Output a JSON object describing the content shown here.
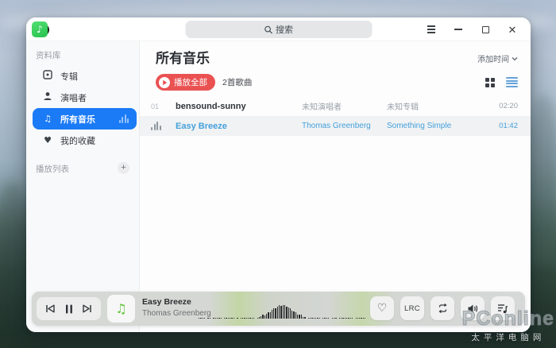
{
  "titlebar": {
    "search_placeholder": "搜索"
  },
  "sidebar": {
    "library_label": "资料库",
    "items": [
      {
        "label": "专辑"
      },
      {
        "label": "演唱者"
      },
      {
        "label": "所有音乐"
      },
      {
        "label": "我的收藏"
      }
    ],
    "playlist_label": "播放列表",
    "add_playlist_glyph": "+"
  },
  "main": {
    "title": "所有音乐",
    "sort_label": "添加时间",
    "play_all_label": "播放全部",
    "song_count": "2首歌曲"
  },
  "songs": [
    {
      "num": "01",
      "title": "bensound-sunny",
      "artist": "未知演唱者",
      "album": "未知专辑",
      "duration": "02:20"
    },
    {
      "num": "",
      "title": "Easy Breeze",
      "artist": "Thomas Greenberg",
      "album": "Something Simple",
      "duration": "01:42"
    }
  ],
  "player": {
    "song_title": "Easy Breeze",
    "song_artist": "Thomas Greenberg",
    "lrc_label": "LRC"
  },
  "watermark": {
    "brand": "PConline",
    "sub": "太平洋电脑网"
  },
  "colors": {
    "accent_blue": "#1b7bf7",
    "accent_red": "#ea5252",
    "playing_blue": "#45a0dc",
    "app_green": "#35cf5a",
    "player_glass": "#d5d7d5"
  }
}
